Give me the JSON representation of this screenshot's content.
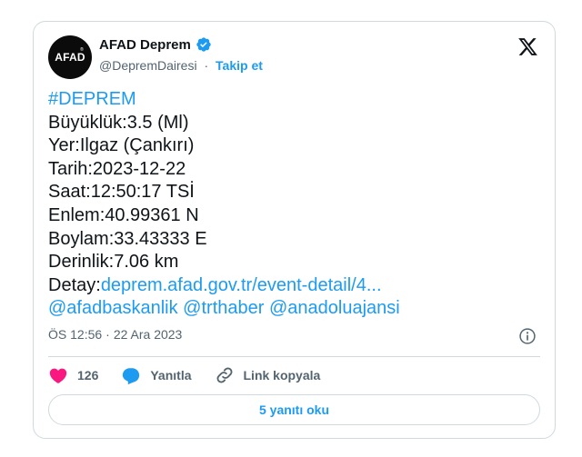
{
  "account": {
    "avatar_text": "AFAD",
    "display_name": "AFAD Deprem",
    "handle": "@DepremDairesi",
    "separator": "·",
    "follow_label": "Takip et"
  },
  "tweet": {
    "hashtag": "#DEPREM",
    "lines": [
      "Büyüklük:3.5 (Ml)",
      "Yer:Ilgaz (Çankırı)",
      "Tarih:2023-12-22",
      "Saat:12:50:17 TSİ",
      "Enlem:40.99361 N",
      "Boylam:33.43333 E",
      "Derinlik:7.06 km"
    ],
    "detail_prefix": "Detay:",
    "detail_link": "deprem.afad.gov.tr/event-detail/4...",
    "mentions": [
      "@afadbaskanlik",
      "@trthaber",
      "@anadoluajansi"
    ]
  },
  "meta": {
    "time": "ÖS 12:56",
    "separator": "·",
    "date": "22 Ara 2023"
  },
  "actions": {
    "likes": "126",
    "reply_label": "Yanıtla",
    "copy_link_label": "Link kopyala"
  },
  "read_replies_label": "5 yanıtı oku",
  "colors": {
    "accent": "#1d9bf0",
    "like": "#f91880",
    "text": "#0f1419",
    "muted": "#536471",
    "border": "#cfd9de"
  }
}
